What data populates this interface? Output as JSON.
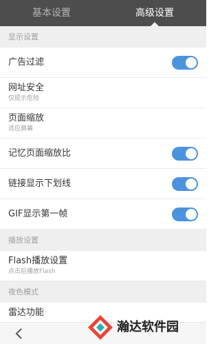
{
  "tabs": [
    {
      "label": "基本设置",
      "active": false
    },
    {
      "label": "高级设置",
      "active": true
    }
  ],
  "sections": [
    {
      "header": "显示设置",
      "rows": [
        {
          "title": "广告过滤",
          "toggle": true
        },
        {
          "title": "网址安全",
          "subtitle": "仅提示危险"
        },
        {
          "title": "页面缩放",
          "subtitle": "适应屏幕"
        },
        {
          "title": "记忆页面缩放比",
          "toggle": true
        },
        {
          "title": "链接显示下划线",
          "toggle": true
        },
        {
          "title": "GIF显示第一帧",
          "toggle": true
        }
      ]
    },
    {
      "header": "播放设置",
      "rows": [
        {
          "title": "Flash播放设置",
          "subtitle": "点击后播放Flash"
        }
      ]
    },
    {
      "header": "夜色模式",
      "rows": [
        {
          "title": "雷达功能"
        }
      ]
    }
  ],
  "bottom": {
    "back_icon": "back-arrow-icon"
  },
  "watermark": {
    "text": "瀚达软件园"
  },
  "colors": {
    "accent": "#4b93dd",
    "tabbar": "#4d4d4d",
    "section_bg": "#efefef"
  }
}
